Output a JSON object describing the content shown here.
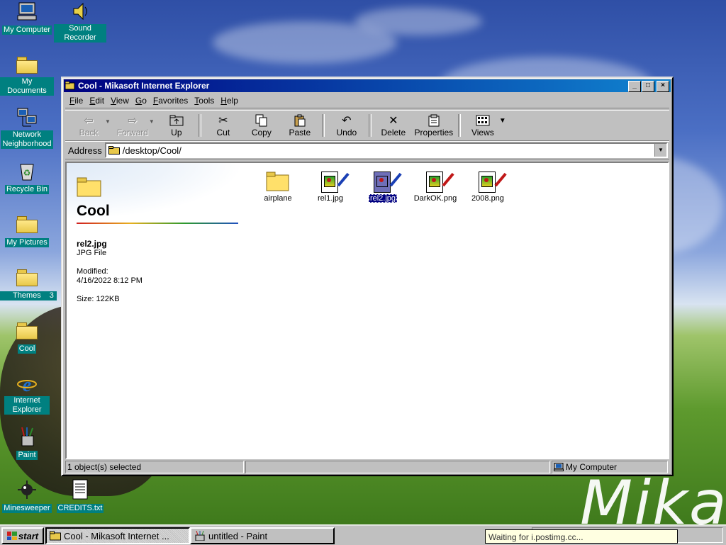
{
  "desktop": {
    "icons": [
      {
        "label": "My Computer"
      },
      {
        "label": "Sound Recorder"
      },
      {
        "label": "My Documents"
      },
      {
        "label": "Network Neighborhood"
      },
      {
        "label": "Recycle Bin"
      },
      {
        "label": "My Pictures"
      },
      {
        "label": "Themes"
      },
      {
        "label": "Cool"
      },
      {
        "label": "Internet Explorer"
      },
      {
        "label": "Paint"
      },
      {
        "label": "Minesweeper"
      },
      {
        "label": "CREDITS.txt"
      }
    ],
    "themes_suffix": "3",
    "wallpaper_text": "Mikas"
  },
  "window": {
    "title": "Cool - Mikasoft Internet Explorer",
    "controls": {
      "minimize": "_",
      "maximize": "□",
      "close": "×"
    },
    "menu": [
      {
        "key": "F",
        "rest": "ile"
      },
      {
        "key": "E",
        "rest": "dit"
      },
      {
        "key": "V",
        "rest": "iew"
      },
      {
        "key": "G",
        "rest": "o"
      },
      {
        "key": "F",
        "rest": "avorites"
      },
      {
        "key": "T",
        "rest": "ools"
      },
      {
        "key": "H",
        "rest": "elp"
      }
    ],
    "toolbar": {
      "back": "Back",
      "forward": "Forward",
      "up": "Up",
      "cut": "Cut",
      "copy": "Copy",
      "paste": "Paste",
      "undo": "Undo",
      "delete": "Delete",
      "properties": "Properties",
      "views": "Views"
    },
    "address": {
      "label": "Address",
      "value": "/desktop/Cool/"
    },
    "webview": {
      "title": "Cool",
      "selected_name": "rel2.jpg",
      "selected_type": "JPG File",
      "modified_label": "Modified:",
      "modified_value": "4/16/2022 8:12 PM",
      "size_label": "Size: 122KB"
    },
    "files": [
      {
        "name": "airplane",
        "kind": "folder"
      },
      {
        "name": "rel1.jpg",
        "kind": "image"
      },
      {
        "name": "rel2.jpg",
        "kind": "image",
        "selected": true
      },
      {
        "name": "DarkOK.png",
        "kind": "image"
      },
      {
        "name": "2008.png",
        "kind": "image"
      }
    ],
    "status": {
      "left": "1 object(s) selected",
      "middle": "",
      "right": "My Computer"
    }
  },
  "taskbar": {
    "start": "start",
    "tasks": [
      {
        "label": "Cool - Mikasoft Internet ...",
        "active": true
      },
      {
        "label": "untitled - Paint",
        "active": false
      }
    ],
    "tooltip": "Waiting for i.postimg.cc..."
  },
  "colors": {
    "titlebar_start": "#000080",
    "titlebar_end": "#1084d0",
    "selection": "#000080",
    "icon_label_bg": "#008080"
  }
}
